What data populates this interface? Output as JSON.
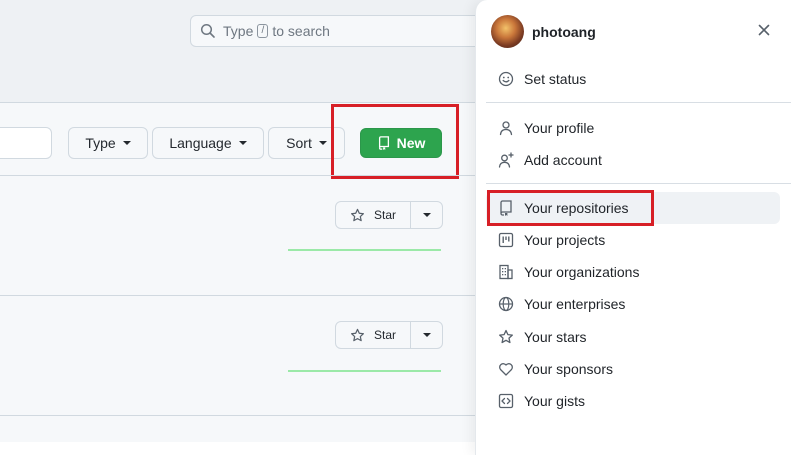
{
  "search": {
    "prefix": "Type",
    "key": "/",
    "suffix": "to search"
  },
  "filters": {
    "type_label": "Type",
    "language_label": "Language",
    "sort_label": "Sort"
  },
  "new_button": {
    "label": "New"
  },
  "repos": [
    {
      "star_label": "Star"
    },
    {
      "star_label": "Star"
    }
  ],
  "menu": {
    "username": "photoang",
    "items": [
      {
        "label": "Set status",
        "icon": "smiley-icon"
      },
      {
        "label": "Your profile",
        "icon": "person-icon"
      },
      {
        "label": "Add account",
        "icon": "person-add-icon"
      },
      {
        "label": "Your repositories",
        "icon": "repo-icon"
      },
      {
        "label": "Your projects",
        "icon": "project-icon"
      },
      {
        "label": "Your organizations",
        "icon": "organization-icon"
      },
      {
        "label": "Your enterprises",
        "icon": "globe-icon"
      },
      {
        "label": "Your stars",
        "icon": "star-icon"
      },
      {
        "label": "Your sponsors",
        "icon": "heart-icon"
      },
      {
        "label": "Your gists",
        "icon": "code-square-icon"
      }
    ]
  },
  "colors": {
    "primary_green": "#2da44e",
    "highlight_red": "#d71f26",
    "spark_green": "#9be9a8"
  }
}
